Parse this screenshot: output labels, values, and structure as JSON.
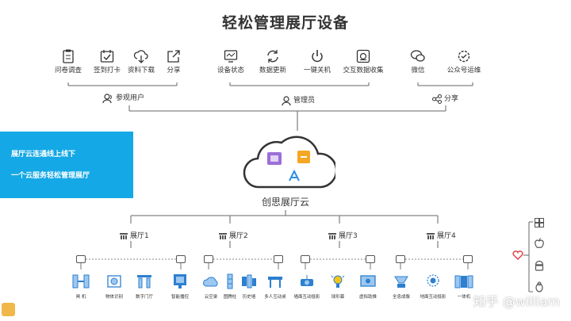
{
  "title": "轻松管理展厅设备",
  "groups": [
    {
      "label": "参观用户",
      "icon": "user-icon",
      "items": [
        {
          "label": "问卷调查",
          "icon": "clipboard-icon"
        },
        {
          "label": "签到打卡",
          "icon": "calendar-check-icon"
        },
        {
          "label": "资料下载",
          "icon": "cloud-download-icon"
        },
        {
          "label": "分享",
          "icon": "share-arrow-icon"
        }
      ]
    },
    {
      "label": "管理员",
      "icon": "admin-icon",
      "items": [
        {
          "label": "设备状态",
          "icon": "monitor-icon"
        },
        {
          "label": "数据更新",
          "icon": "refresh-icon"
        },
        {
          "label": "一键关机",
          "icon": "power-icon"
        },
        {
          "label": "交互数据收集",
          "icon": "data-collect-icon"
        }
      ]
    },
    {
      "label": "分享",
      "icon": "share-nodes-icon",
      "items": [
        {
          "label": "微信",
          "icon": "wechat-icon"
        },
        {
          "label": "公众号运维",
          "icon": "badge-settings-icon"
        }
      ]
    }
  ],
  "banner": {
    "line1": "展厅云连通线上线下",
    "line2": "一个云服务轻松管理展厅",
    "color": "#14a8e6"
  },
  "cloud": {
    "label": "创思展厅云"
  },
  "halls": [
    {
      "label": "展厅1",
      "devices": [
        {
          "label": "闸 机"
        },
        {
          "label": "物体识别"
        },
        {
          "label": "数字门厅"
        },
        {
          "label": "智能播控"
        }
      ]
    },
    {
      "label": "展厅2",
      "devices": [
        {
          "label": "云空录"
        },
        {
          "label": "图腾柱"
        },
        {
          "label": "历史墙"
        },
        {
          "label": "多人互动桌"
        }
      ]
    },
    {
      "label": "展厅3",
      "devices": [
        {
          "label": "墙面互动投影"
        },
        {
          "label": "球形幕"
        },
        {
          "label": "虚拟助推"
        }
      ]
    },
    {
      "label": "展厅4",
      "devices": [
        {
          "label": "全息成像"
        },
        {
          "label": "地面互动投影"
        },
        {
          "label": "一体机"
        }
      ]
    }
  ],
  "os_icons": [
    "windows-icon",
    "apple-icon",
    "android-icon",
    "linux-icon"
  ],
  "watermark": "知乎 @william",
  "accent": "#14a8e6"
}
